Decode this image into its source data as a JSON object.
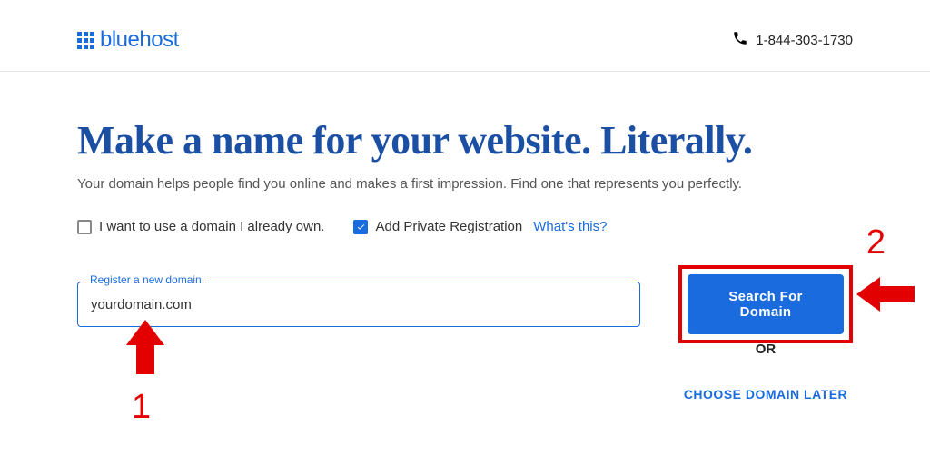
{
  "header": {
    "brand": "bluehost",
    "phone": "1-844-303-1730"
  },
  "hero": {
    "headline": "Make a name for your website. Literally.",
    "subhead": "Your domain helps people find you online and makes a first impression. Find one that represents you perfectly."
  },
  "options": {
    "own_domain_label": "I want to use a domain I already own.",
    "own_domain_checked": false,
    "private_reg_label": "Add Private Registration",
    "private_reg_checked": true,
    "whats_this": "What's this?"
  },
  "search": {
    "input_label": "Register a new domain",
    "value": "yourdomain.com",
    "button": "Search For Domain",
    "or_text": "OR",
    "later": "CHOOSE DOMAIN LATER"
  },
  "annotations": {
    "n1": "1",
    "n2": "2"
  }
}
